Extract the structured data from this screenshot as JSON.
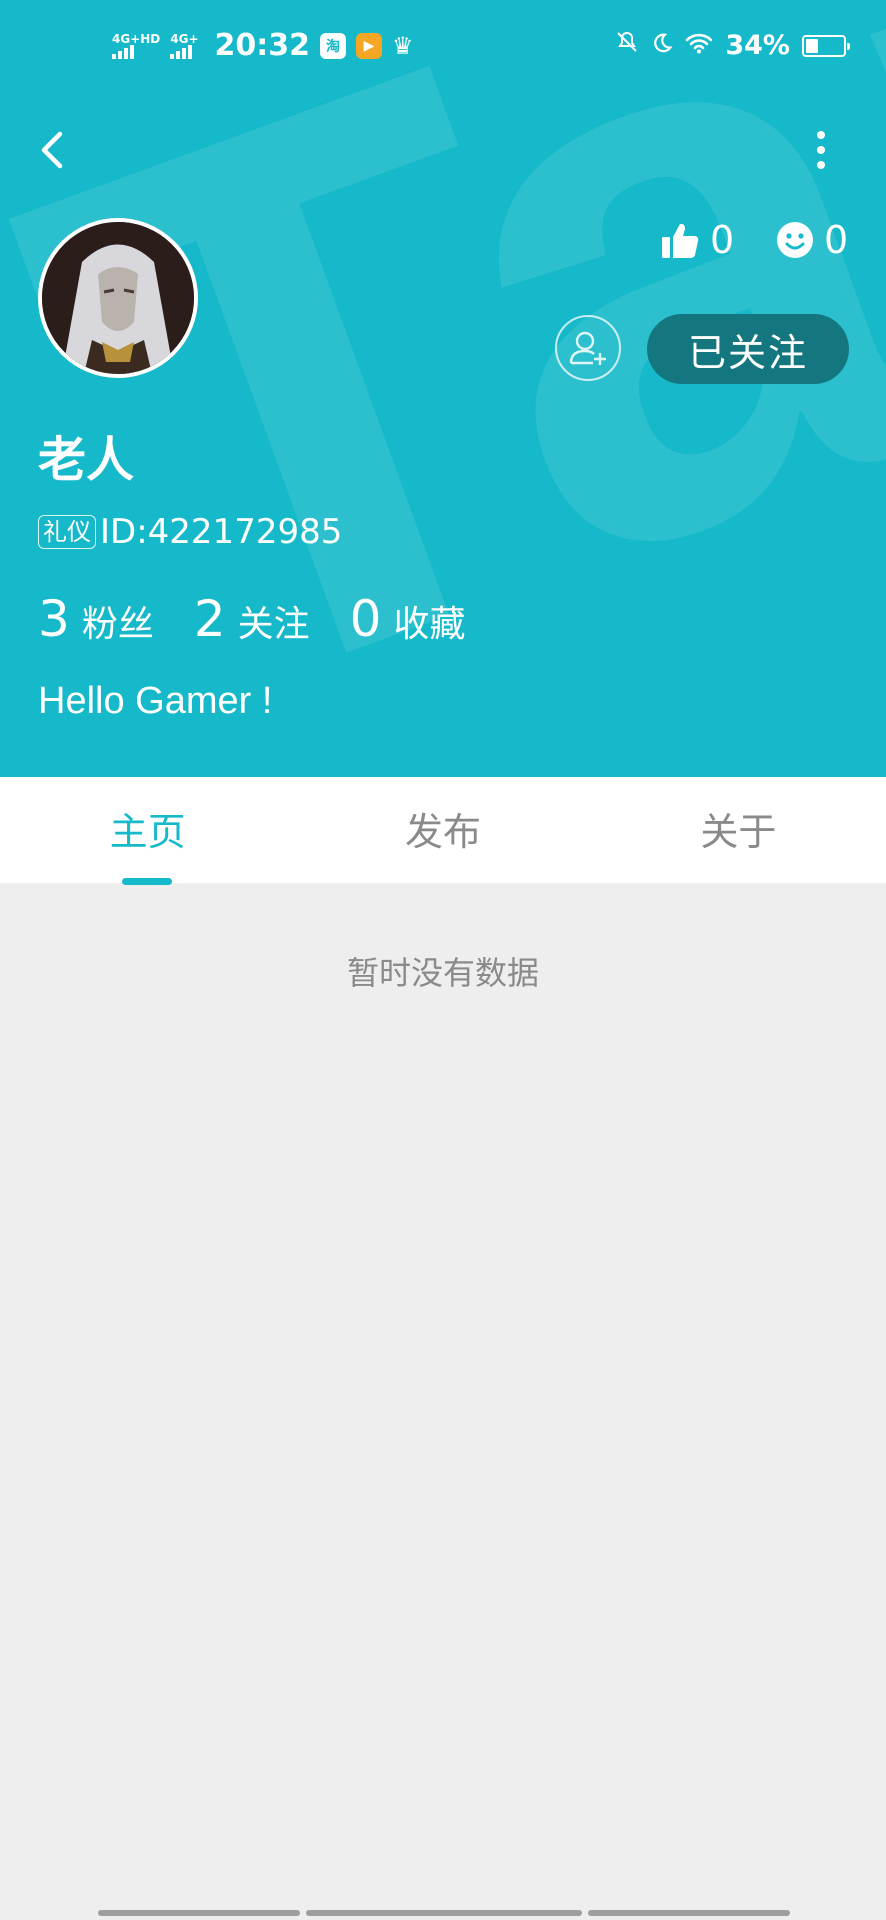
{
  "status_bar": {
    "network1": "4G+HD",
    "network2": "4G+",
    "time": "20:32",
    "app1": "淘",
    "battery": "34%",
    "battery_level": 0.34
  },
  "profile": {
    "name": "老人",
    "tag": "礼仪",
    "id_text": "ID:422172985",
    "likes": "0",
    "emotes": "0",
    "follow_button": "已关注",
    "fans_count": "3",
    "fans_label": "粉丝",
    "following_count": "2",
    "following_label": "关注",
    "favorites_count": "0",
    "favorites_label": "收藏",
    "bio": "Hello Gamer !"
  },
  "tabs": [
    {
      "label": "主页",
      "active": true
    },
    {
      "label": "发布",
      "active": false
    },
    {
      "label": "关于",
      "active": false
    }
  ],
  "content": {
    "empty_text": "暂时没有数据"
  },
  "colors": {
    "accent": "#15b9c9",
    "follow_button_bg": "#14767f",
    "page_bg": "#eeeeee"
  }
}
